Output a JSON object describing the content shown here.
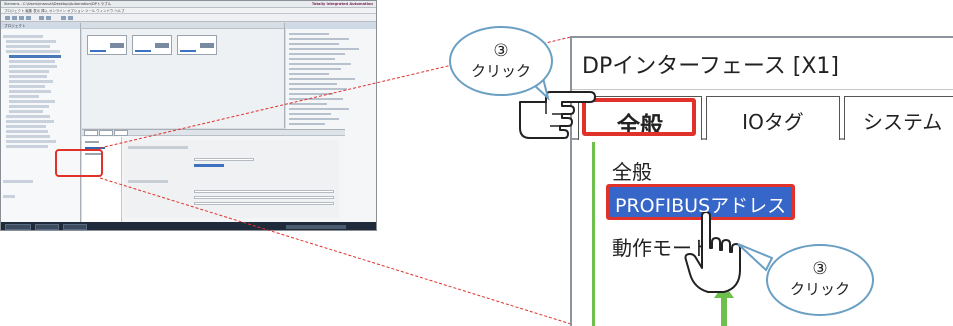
{
  "mini_screenshot": {
    "title": "Siemens - C:\\Users\\manual\\Desktop\\Automation\\DPトラブル",
    "title_right": "Totally Integrated Automation",
    "menu": "プロジェクト 編集 表示 挿入 オンライン オプション ツール ウィンドウ ヘルプ",
    "tree_header": "プロジェクト",
    "colors": {
      "frame": "#d8dce2",
      "status_bar": "#1f2b3a",
      "highlight": "#e0312b"
    }
  },
  "zoom": {
    "window_title": "DPインターフェース [X1]",
    "tabs": [
      {
        "label": "全般",
        "selected": true
      },
      {
        "label": "IOタグ",
        "selected": false
      },
      {
        "label": "システム",
        "selected": false
      }
    ],
    "nav_items": [
      {
        "label": "全般"
      },
      {
        "label": "PROFIBUSアドレス",
        "selected": true
      },
      {
        "label": "動作モード"
      }
    ]
  },
  "callouts": {
    "top": {
      "number": "③",
      "label": "クリック"
    },
    "bottom": {
      "number": "③",
      "label": "クリック"
    }
  },
  "colors": {
    "highlight_red": "#e0312b",
    "selection_blue": "#3566c8",
    "bubble_border": "#6a9fc4",
    "guide_line": "#6fbf4d"
  }
}
